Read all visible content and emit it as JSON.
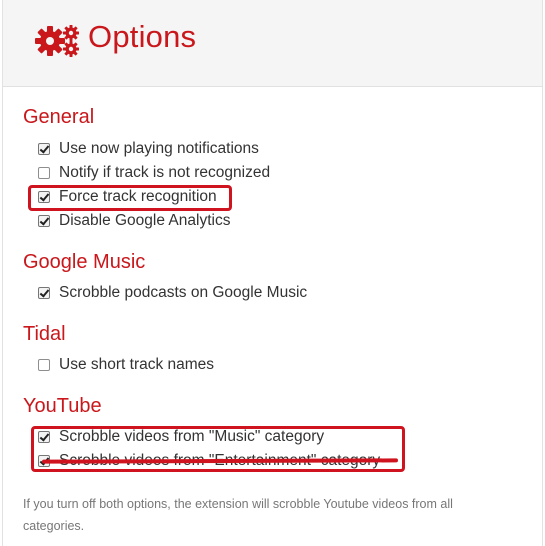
{
  "header": {
    "title": "Options",
    "icon": "gears-icon"
  },
  "sections": {
    "general": {
      "title": "General",
      "options": [
        {
          "label": "Use now playing notifications",
          "checked": true
        },
        {
          "label": "Notify if track is not recognized",
          "checked": false
        },
        {
          "label": "Force track recognition",
          "checked": true,
          "highlighted": true
        },
        {
          "label": "Disable Google Analytics",
          "checked": true
        }
      ]
    },
    "google_music": {
      "title": "Google Music",
      "options": [
        {
          "label": "Scrobble podcasts on Google Music",
          "checked": true
        }
      ]
    },
    "tidal": {
      "title": "Tidal",
      "options": [
        {
          "label": "Use short track names",
          "checked": false
        }
      ]
    },
    "youtube": {
      "title": "YouTube",
      "options": [
        {
          "label": "Scrobble videos from \"Music\" category",
          "checked": true,
          "highlighted": true
        },
        {
          "label": "Scrobble videos from \"Entertainment\" category",
          "checked": true,
          "highlighted": true,
          "struck_through": true
        }
      ],
      "note": "If you turn off both options, the extension will scrobble Youtube videos from all categories."
    }
  },
  "colors": {
    "accent": "#c9171b",
    "annotation": "#d0141f",
    "header_bg": "#f5f5f5"
  }
}
